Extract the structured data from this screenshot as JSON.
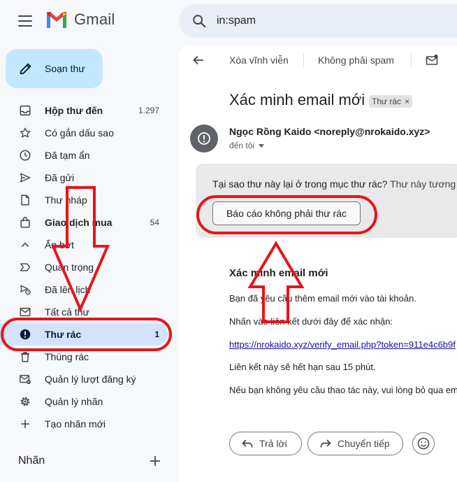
{
  "app": {
    "name": "Gmail"
  },
  "search": {
    "query": "in:spam"
  },
  "compose": {
    "label": "Soạn thư"
  },
  "nav": [
    {
      "label": "Hộp thư đến",
      "count": "1.297",
      "icon": "inbox-icon",
      "bold": true,
      "active": false
    },
    {
      "label": "Có gắn dấu sao",
      "count": "",
      "icon": "star-icon",
      "bold": false,
      "active": false
    },
    {
      "label": "Đã tạm ẩn",
      "count": "",
      "icon": "clock-icon",
      "bold": false,
      "active": false
    },
    {
      "label": "Đã gửi",
      "count": "",
      "icon": "send-icon",
      "bold": false,
      "active": false
    },
    {
      "label": "Thư nháp",
      "count": "",
      "icon": "draft-icon",
      "bold": false,
      "active": false
    },
    {
      "label": "Giao dịch mua",
      "count": "54",
      "icon": "shopping-bag-icon",
      "bold": true,
      "active": false
    },
    {
      "label": "Ẩn bớt",
      "count": "",
      "icon": "chevron-up-icon",
      "bold": false,
      "active": false
    },
    {
      "label": "Quan trọng",
      "count": "",
      "icon": "important-icon",
      "bold": false,
      "active": false
    },
    {
      "label": "Đã lên lịch",
      "count": "",
      "icon": "scheduled-icon",
      "bold": false,
      "active": false
    },
    {
      "label": "Tất cả thư",
      "count": "",
      "icon": "all-mail-icon",
      "bold": false,
      "active": false
    },
    {
      "label": "Thư rác",
      "count": "1",
      "icon": "spam-icon",
      "bold": true,
      "active": true
    },
    {
      "label": "Thùng rác",
      "count": "",
      "icon": "trash-icon",
      "bold": false,
      "active": false
    },
    {
      "label": "Quản lý lượt đăng ký",
      "count": "",
      "icon": "subscriptions-icon",
      "bold": false,
      "active": false
    },
    {
      "label": "Quản lý nhãn",
      "count": "",
      "icon": "settings-icon",
      "bold": false,
      "active": false
    },
    {
      "label": "Tạo nhãn mới",
      "count": "",
      "icon": "plus-icon",
      "bold": false,
      "active": false
    }
  ],
  "labels_section": {
    "title": "Nhãn"
  },
  "toolbar": {
    "delete_forever": "Xóa vĩnh viễn",
    "not_spam": "Không phải spam"
  },
  "email": {
    "subject": "Xác minh email mới",
    "label_chip": "Thư rác",
    "chip_close": "×",
    "sender": "Ngọc Rồng Kaido <noreply@nrokaido.xyz>",
    "recipient": "đến tôi",
    "banner_text": "Tại sao thư này lại ở trong mục thư rác?",
    "banner_text_rest": " Thư này tương",
    "report_not_spam": "Báo cáo không phải thư rác",
    "body_title": "Xác minh email mới",
    "body_line1": "Bạn đã yêu cầu thêm email mới vào tài khoản.",
    "body_line2": "Nhấn vào liên kết dưới đây để xác nhận:",
    "body_link": "https://nrokaido.xyz/verify_email.php?token=911e4c6b9f",
    "body_line3": "Liên kết này sẽ hết hạn sau 15 phút.",
    "body_line4": "Nếu bạn không yêu cầu thao tác này, vui lòng bỏ qua em"
  },
  "actions": {
    "reply": "Trả lời",
    "forward": "Chuyển tiếp"
  },
  "colors": {
    "accent": "#c2e7ff",
    "active_nav": "#d3e3fd",
    "annotation": "#e8141a",
    "link": "#1a0dab"
  }
}
